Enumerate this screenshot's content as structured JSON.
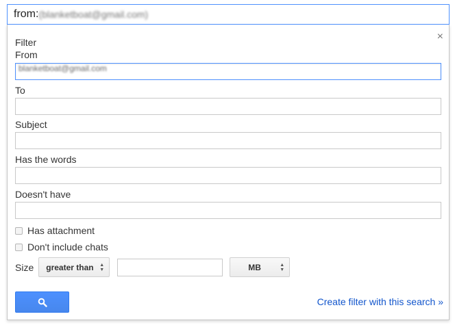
{
  "search": {
    "query_prefix": "from:",
    "query_rest": "(blanketboat@gmail.com)"
  },
  "panel": {
    "title": "Filter",
    "close_glyph": "×",
    "from_label": "From",
    "from_value": "blanketboat@gmail.com",
    "to_label": "To",
    "subject_label": "Subject",
    "has_words_label": "Has the words",
    "doesnt_have_label": "Doesn't have",
    "has_attachment_label": "Has attachment",
    "dont_include_chats_label": "Don't include chats",
    "size_label": "Size",
    "size_operator": "greater than",
    "size_unit": "MB",
    "create_filter_link": "Create filter with this search »"
  },
  "icons": {
    "search": "magnifier-icon",
    "close": "close-icon",
    "select_arrows": "up-down-arrows-icon"
  },
  "colors": {
    "accent": "#4d90fe",
    "link": "#1155cc",
    "button_bg": "#4d90fe"
  }
}
